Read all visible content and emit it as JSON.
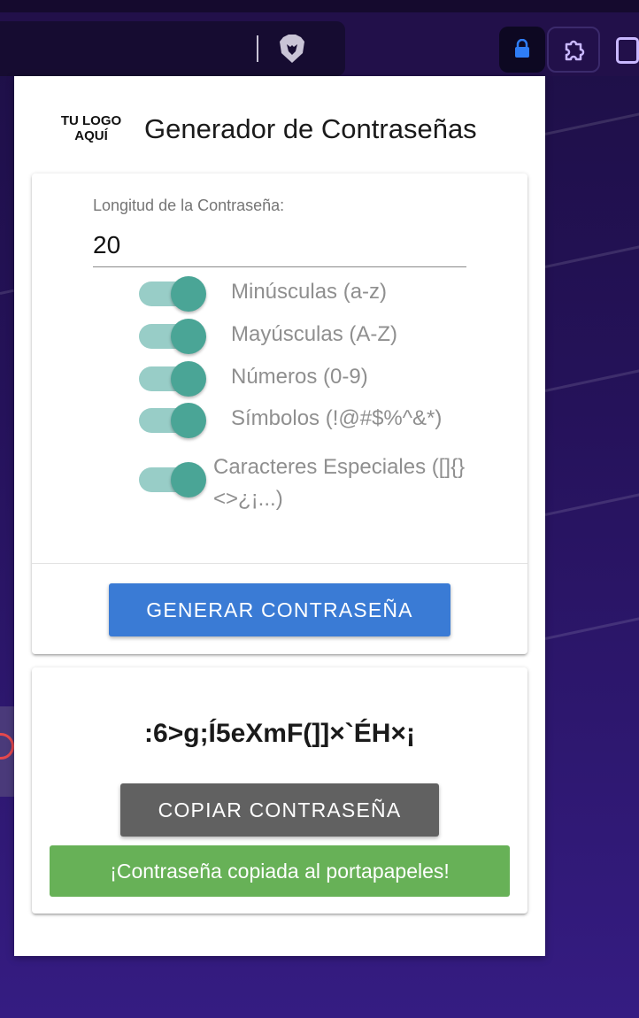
{
  "popup": {
    "logo_line1": "TU LOGO",
    "logo_line2": "AQUÍ",
    "title": "Generador de Contraseñas"
  },
  "settings": {
    "length_label": "Longitud de la Contraseña:",
    "length_value": "20",
    "options": [
      {
        "label": "Minúsculas (a-z)",
        "enabled": true
      },
      {
        "label": "Mayúsculas (A-Z)",
        "enabled": true
      },
      {
        "label": "Números (0-9)",
        "enabled": true
      },
      {
        "label": "Símbolos (!@#$%^&*)",
        "enabled": true
      },
      {
        "label": "Caracteres Especiales ([]{}<>¿¡...)",
        "enabled": true
      }
    ],
    "generate_label": "GENERAR CONTRASEÑA"
  },
  "result": {
    "password": ":6>g;Í5eXmF(]]×`ÉH×¡",
    "copy_label": "COPIAR CONTRASEÑA",
    "toast": "¡Contraseña copiada al portapapeles!"
  },
  "colors": {
    "generate_button": "#3a7bd5",
    "copy_button": "#616161",
    "toast": "#67b157",
    "toggle_thumb": "#4aa596",
    "toggle_track": "#98cdc7"
  }
}
